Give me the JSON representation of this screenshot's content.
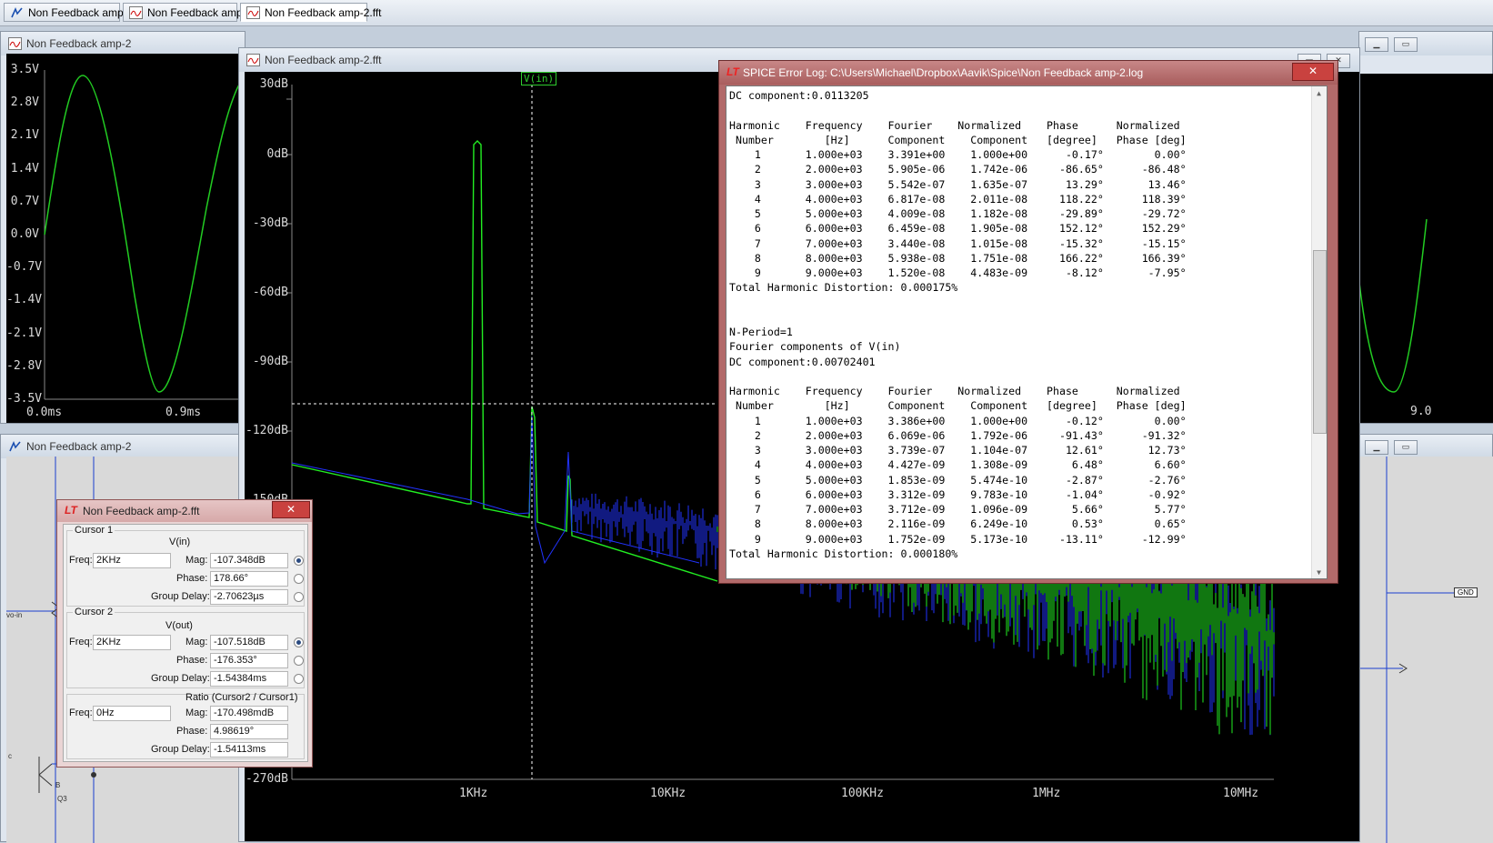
{
  "tabs": [
    {
      "label": "Non Feedback amp-2"
    },
    {
      "label": "Non Feedback amp-2"
    },
    {
      "label": "Non Feedback amp-2.fft"
    }
  ],
  "time_window": {
    "title": "Non Feedback amp-2",
    "y_ticks": [
      "3.5V",
      "2.8V",
      "2.1V",
      "1.4V",
      "0.7V",
      "0.0V",
      "-0.7V",
      "-1.4V",
      "-2.1V",
      "-2.8V",
      "-3.5V"
    ],
    "x_ticks": [
      "0.0ms",
      "0.9ms"
    ],
    "right_x_tick": "9.0",
    "waveform_color": "#22cc22"
  },
  "schematic_window": {
    "title": "Non Feedback amp-2",
    "labels": {
      "in": "vo-in",
      "c": "c",
      "b": "B",
      "q": "Q3",
      "gnd": "GND"
    }
  },
  "fft_window": {
    "title": "Non Feedback amp-2.fft",
    "trace_label": "V(in)",
    "y_ticks": [
      "30dB",
      "0dB",
      "-30dB",
      "-60dB",
      "-90dB",
      "-120dB",
      "-150dB",
      "-270dB"
    ],
    "x_ticks": [
      "1KHz",
      "10KHz",
      "100KHz",
      "1MHz",
      "10MHz"
    ],
    "colors": {
      "vin": "#22ee22",
      "vout": "#2233ff",
      "cursor": "#ffffff"
    }
  },
  "log_window": {
    "title": "SPICE Error Log: C:\\Users\\Michael\\Dropbox\\Aavik\\Spice\\Non Feedback amp-2.log",
    "lines": [
      "DC component:0.0113205",
      "",
      "Harmonic    Frequency    Fourier    Normalized    Phase      Normalized",
      " Number        [Hz]      Component    Component   [degree]   Phase [deg]",
      "    1       1.000e+03    3.391e+00    1.000e+00      -0.17°        0.00°",
      "    2       2.000e+03    5.905e-06    1.742e-06     -86.65°      -86.48°",
      "    3       3.000e+03    5.542e-07    1.635e-07      13.29°       13.46°",
      "    4       4.000e+03    6.817e-08    2.011e-08     118.22°      118.39°",
      "    5       5.000e+03    4.009e-08    1.182e-08     -29.89°      -29.72°",
      "    6       6.000e+03    6.459e-08    1.905e-08     152.12°      152.29°",
      "    7       7.000e+03    3.440e-08    1.015e-08     -15.32°      -15.15°",
      "    8       8.000e+03    5.938e-08    1.751e-08     166.22°      166.39°",
      "    9       9.000e+03    1.520e-08    4.483e-09      -8.12°       -7.95°",
      "Total Harmonic Distortion: 0.000175%",
      "",
      "",
      "N-Period=1",
      "Fourier components of V(in)",
      "DC component:0.00702401",
      "",
      "Harmonic    Frequency    Fourier    Normalized    Phase      Normalized",
      " Number        [Hz]      Component    Component   [degree]   Phase [deg]",
      "    1       1.000e+03    3.386e+00    1.000e+00      -0.12°        0.00°",
      "    2       2.000e+03    6.069e-06    1.792e-06     -91.43°      -91.32°",
      "    3       3.000e+03    3.739e-07    1.104e-07      12.61°       12.73°",
      "    4       4.000e+03    4.427e-09    1.308e-09       6.48°        6.60°",
      "    5       5.000e+03    1.853e-09    5.474e-10      -2.87°       -2.76°",
      "    6       6.000e+03    3.312e-09    9.783e-10      -1.04°       -0.92°",
      "    7       7.000e+03    3.712e-09    1.096e-09       5.66°        5.77°",
      "    8       8.000e+03    2.116e-09    6.249e-10       0.53°        0.65°",
      "    9       9.000e+03    1.752e-09    5.173e-10     -13.11°      -12.99°",
      "Total Harmonic Distortion: 0.000180%"
    ]
  },
  "cursor_window": {
    "title": "Non Feedback amp-2.fft",
    "cursor1": {
      "group": "Cursor 1",
      "trace": "V(in)",
      "freq_label": "Freq:",
      "freq": "2KHz",
      "mag_label": "Mag:",
      "mag": "-107.348dB",
      "phase_label": "Phase:",
      "phase": "178.66°",
      "gd_label": "Group Delay:",
      "gd": "-2.70623µs"
    },
    "cursor2": {
      "group": "Cursor 2",
      "trace": "V(out)",
      "freq_label": "Freq:",
      "freq": "2KHz",
      "mag_label": "Mag:",
      "mag": "-107.518dB",
      "phase_label": "Phase:",
      "phase": "-176.353°",
      "gd_label": "Group Delay:",
      "gd": "-1.54384ms"
    },
    "ratio": {
      "group": "Ratio (Cursor2 / Cursor1)",
      "freq_label": "Freq:",
      "freq": "0Hz",
      "mag_label": "Mag:",
      "mag": "-170.498mdB",
      "phase_label": "Phase:",
      "phase": "4.98619°",
      "gd_label": "Group Delay:",
      "gd": "-1.54113ms"
    }
  }
}
